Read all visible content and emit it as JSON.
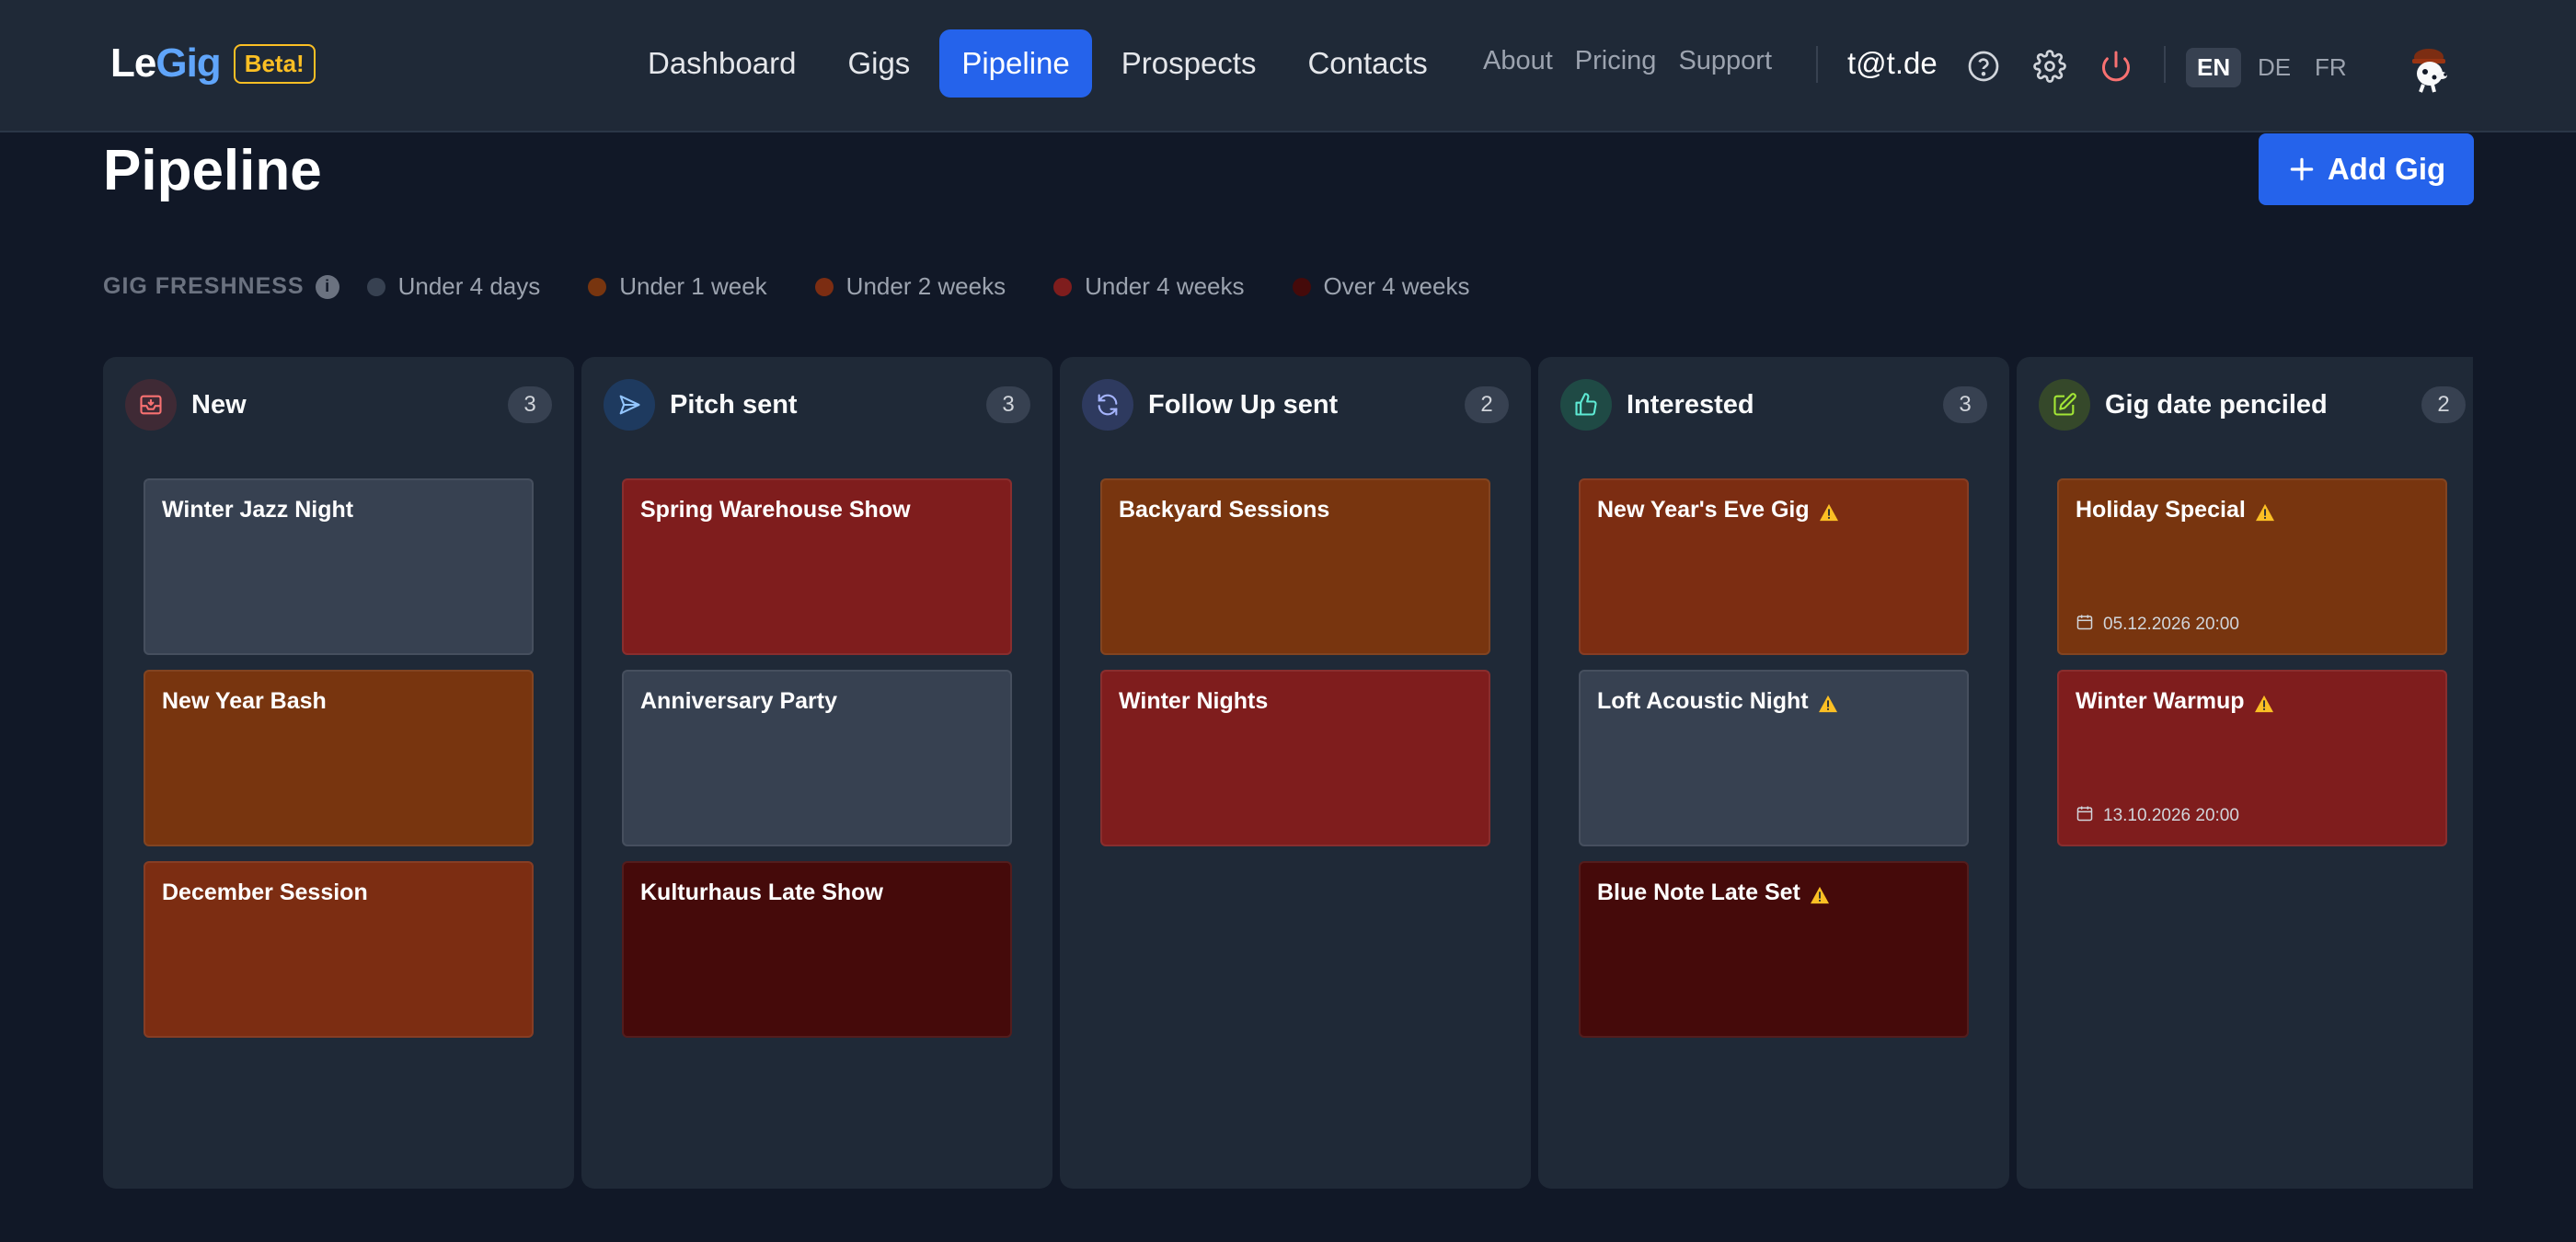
{
  "header": {
    "logo_le": "Le",
    "logo_gig": "Gig",
    "beta": "Beta!",
    "nav": [
      "Dashboard",
      "Gigs",
      "Pipeline",
      "Prospects",
      "Contacts"
    ],
    "active_nav": "Pipeline",
    "subnav": [
      "About",
      "Pricing",
      "Support"
    ],
    "user_email": "t@t.de",
    "icons": [
      "help-icon",
      "settings-icon",
      "power-icon"
    ],
    "languages": [
      "EN",
      "DE",
      "FR"
    ],
    "active_language": "EN"
  },
  "page": {
    "title": "Pipeline",
    "add_button": "Add Gig"
  },
  "freshness": {
    "title": "GIG FRESHNESS",
    "items": [
      {
        "label": "Under 4 days",
        "color": "#374151"
      },
      {
        "label": "Under 1 week",
        "color": "#78350f"
      },
      {
        "label": "Under 2 weeks",
        "color": "#7c2d12"
      },
      {
        "label": "Under 4 weeks",
        "color": "#7f1d1d"
      },
      {
        "label": "Over 4 weeks",
        "color": "#450a0a"
      }
    ]
  },
  "columns": [
    {
      "title": "New",
      "count": "3",
      "icon": "inbox-icon",
      "icon_bg": "#3f2a35",
      "icon_color": "#f87171",
      "cards": [
        {
          "title": "Winter Jazz Night",
          "color": "#374151",
          "warning": false,
          "date": ""
        },
        {
          "title": "New Year Bash",
          "color": "#78350f",
          "warning": false,
          "date": ""
        },
        {
          "title": "December Session",
          "color": "#7c2d12",
          "warning": false,
          "date": ""
        }
      ]
    },
    {
      "title": "Pitch sent",
      "count": "3",
      "icon": "send-icon",
      "icon_bg": "#1e3a5f",
      "icon_color": "#93c5fd",
      "cards": [
        {
          "title": "Spring Warehouse Show",
          "color": "#7f1d1d",
          "warning": false,
          "date": ""
        },
        {
          "title": "Anniversary Party",
          "color": "#374151",
          "warning": false,
          "date": ""
        },
        {
          "title": "Kulturhaus Late Show",
          "color": "#450a0a",
          "warning": false,
          "date": ""
        }
      ]
    },
    {
      "title": "Follow Up sent",
      "count": "2",
      "icon": "refresh-icon",
      "icon_bg": "#2e3a5f",
      "icon_color": "#a5b4fc",
      "cards": [
        {
          "title": "Backyard Sessions",
          "color": "#78350f",
          "warning": false,
          "date": ""
        },
        {
          "title": "Winter Nights",
          "color": "#7f1d1d",
          "warning": false,
          "date": ""
        }
      ]
    },
    {
      "title": "Interested",
      "count": "3",
      "icon": "thumbs-up-icon",
      "icon_bg": "#1f4a45",
      "icon_color": "#5eead4",
      "cards": [
        {
          "title": "New Year's Eve Gig",
          "color": "#7c2d12",
          "warning": true,
          "date": ""
        },
        {
          "title": "Loft Acoustic Night",
          "color": "#374151",
          "warning": true,
          "date": ""
        },
        {
          "title": "Blue Note Late Set",
          "color": "#450a0a",
          "warning": true,
          "date": ""
        }
      ]
    },
    {
      "title": "Gig date penciled",
      "count": "2",
      "icon": "pencil-icon",
      "icon_bg": "#35482a",
      "icon_color": "#a3e635",
      "cards": [
        {
          "title": "Holiday Special",
          "color": "#78350f",
          "warning": true,
          "date": "05.12.2026 20:00"
        },
        {
          "title": "Winter Warmup",
          "color": "#7f1d1d",
          "warning": true,
          "date": "13.10.2026 20:00"
        }
      ]
    }
  ]
}
